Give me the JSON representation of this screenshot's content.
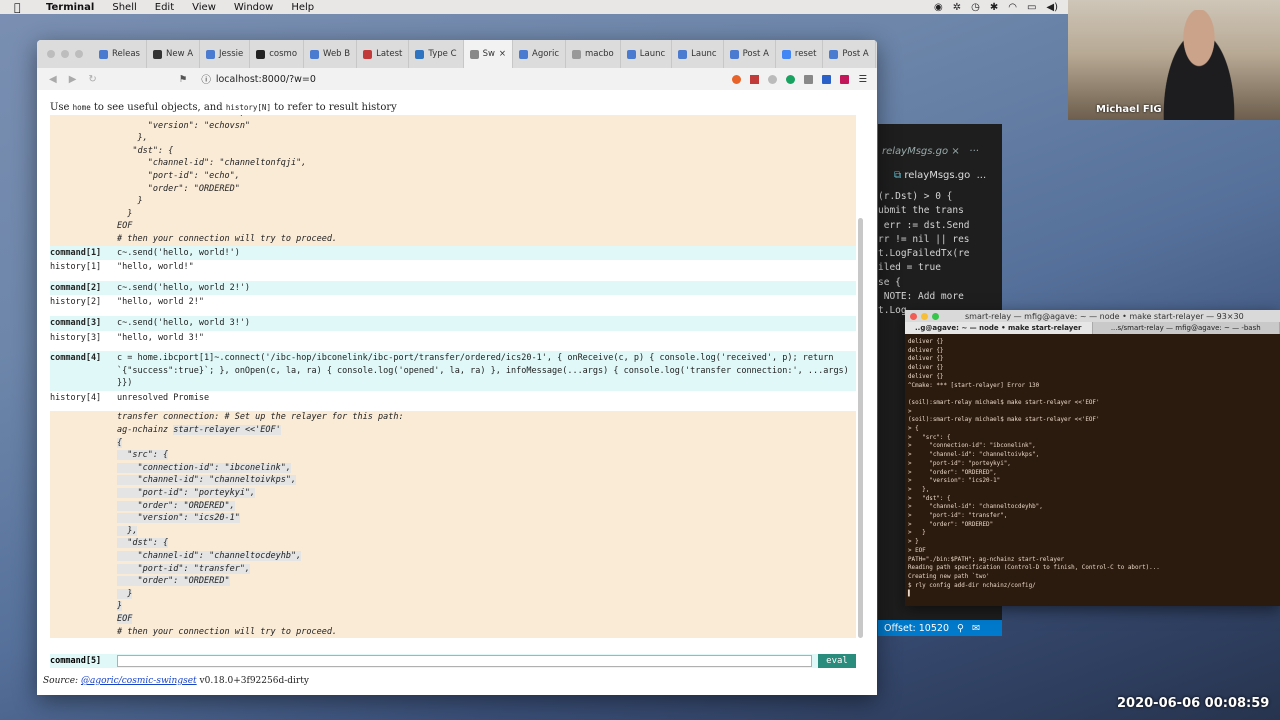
{
  "menubar": {
    "app": "Terminal",
    "items": [
      "Shell",
      "Edit",
      "View",
      "Window",
      "Help"
    ]
  },
  "webcam": {
    "name": "Michael FIG"
  },
  "browser": {
    "tabs": [
      {
        "label": "Releas",
        "color": "#4a7bd0"
      },
      {
        "label": "New A",
        "color": "#333"
      },
      {
        "label": "Jessie",
        "color": "#4a7bd0"
      },
      {
        "label": "cosmo",
        "color": "#222"
      },
      {
        "label": "Web B",
        "color": "#4a7bd0"
      },
      {
        "label": "Latest",
        "color": "#c23b3b"
      },
      {
        "label": "Type C",
        "color": "#2f74c0"
      },
      {
        "label": "Sw",
        "color": "#888"
      },
      {
        "label": "Agoric",
        "color": "#4a7bd0"
      },
      {
        "label": "macbo",
        "color": "#999"
      },
      {
        "label": "Launc",
        "color": "#4a7bd0"
      },
      {
        "label": "Launc",
        "color": "#4a7bd0"
      },
      {
        "label": "Post A",
        "color": "#4a7bd0"
      },
      {
        "label": "reset",
        "color": "#4285f4"
      },
      {
        "label": "Post A",
        "color": "#4a7bd0"
      }
    ],
    "new_tab": "+",
    "url": "localhost:8000/?w=0"
  },
  "repl": {
    "hint_pre": "Use ",
    "hint_home": "home",
    "hint_mid": " to see useful objects, and ",
    "hint_history": "history[N]",
    "hint_post": " to refer to result history",
    "top_block": "      \"order\": \"ORDERED\",\n      \"version\": \"echovsn\"\n    },\n   \"dst\": {\n      \"channel-id\": \"channeltonfqji\",\n      \"port-id\": \"echo\",\n      \"order\": \"ORDERED\"\n    }\n  }\nEOF\n# then your connection will try to proceed.",
    "entries": [
      {
        "cmd_label": "command[1]",
        "cmd": "c~.send('hello, world!')",
        "hist_label": "history[1]",
        "hist": "\"hello, world!\""
      },
      {
        "cmd_label": "command[2]",
        "cmd": "c~.send('hello, world 2!')",
        "hist_label": "history[2]",
        "hist": "\"hello, world 2!\""
      },
      {
        "cmd_label": "command[3]",
        "cmd": "c~.send('hello, world 3!')",
        "hist_label": "history[3]",
        "hist": "\"hello, world 3!\""
      },
      {
        "cmd_label": "command[4]",
        "cmd": "c = home.ibcport[1]~.connect('/ibc-hop/ibconelink/ibc-port/transfer/ordered/ics20-1', { onReceive(c, p) { console.log('received', p); return `{\"success\":true}`; }, onOpen(c, la, ra) { console.log('opened', la, ra) }, infoMessage(...args) { console.log('transfer connection:', ...args) }})",
        "hist_label": "history[4]",
        "hist": "unresolved Promise"
      }
    ],
    "block_line1": "transfer connection: # Set up the relayer for this path:",
    "block_line2_a": "ag-nchainz ",
    "block_line2_b": "start-relayer <<'EOF'",
    "block_rest": "{\n  \"src\": {\n    \"connection-id\": \"ibconelink\",\n    \"channel-id\": \"channeltoivkps\",\n    \"port-id\": \"porteykyi\",\n    \"order\": \"ORDERED\",\n    \"version\": \"ics20-1\"\n  },\n  \"dst\": {\n    \"channel-id\": \"channeltocdeyhb\",\n    \"port-id\": \"transfer\",\n    \"order\": \"ORDERED\"\n  }\n}\nEOF",
    "block_last": "# then your connection will try to proceed.",
    "input_label": "command[5]",
    "input_value": "",
    "eval_label": "eval",
    "source_label": "Source: ",
    "source_link": "@agoric/cosmic-swingset",
    "source_version": " v0.18.0+3f92256d-dirty"
  },
  "vscode": {
    "tab_a": "relayMsgs.go",
    "tab_b": "relayMsgs.go",
    "ellipsis": "...",
    "code": "(r.Dst) > 0 {\nubmit the trans\n err := dst.Send\nrr != nil || res\nt.LogFailedTx(re\niled = true\nse {\n NOTE: Add more\nt.Log",
    "status": "Offset: 10520"
  },
  "terminal": {
    "title": "smart-relay — mfig@agave: ~ — node • make start-relayer — 93×30",
    "tab1": "..g@agave: ~ — node • make start-relayer",
    "tab2": "...s/smart-relay — mfig@agave: ~ — -bash",
    "output": "deliver {}\ndeliver {}\ndeliver {}\ndeliver {}\ndeliver {}\n^Cmake: *** [start-relayer] Error 130\n\n(soil):smart-relay michael$ make start-relayer <<'EOF'\n>\n(soil):smart-relay michael$ make start-relayer <<'EOF'\n> {\n>   \"src\": {\n>     \"connection-id\": \"ibconelink\",\n>     \"channel-id\": \"channeltoivkps\",\n>     \"port-id\": \"porteykyi\",\n>     \"order\": \"ORDERED\",\n>     \"version\": \"ics20-1\"\n>   },\n>   \"dst\": {\n>     \"channel-id\": \"channeltocdeyhb\",\n>     \"port-id\": \"transfer\",\n>     \"order\": \"ORDERED\"\n>   }\n> }\n> EOF\nPATH=\"./bin:$PATH\"; ag-nchainz start-relayer\nReading path specification (Control-D to finish, Control-C to abort)...\nCreating new path `two'\n$ rly config add-dir nchainz/config/\n▌"
  },
  "timestamp": "2020-06-06 00:08:59"
}
